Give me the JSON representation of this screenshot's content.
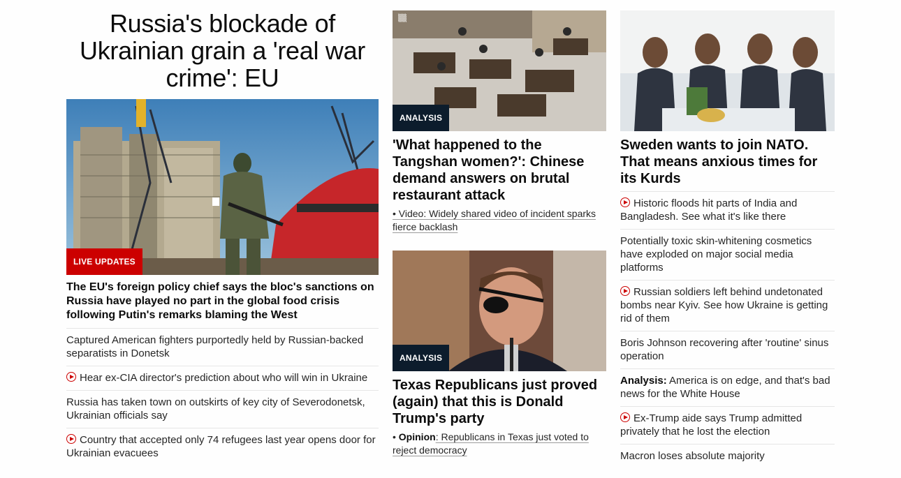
{
  "col1": {
    "headline": "Russia's blockade of Ukrainian grain a 'real war crime': EU",
    "badge": "LIVE UPDATES",
    "story_headline": "The EU's foreign policy chief says the bloc's sanctions on Russia have played no part in the global food crisis following Putin's remarks blaming the West",
    "links": [
      {
        "text": "Captured American fighters purportedly held by Russian-backed separatists in Donetsk",
        "video": false
      },
      {
        "text": "Hear ex-CIA director's prediction about who will win in Ukraine",
        "video": true
      },
      {
        "text": "Russia has taken town on outskirts of key city of Severodonetsk, Ukrainian officials say",
        "video": false
      },
      {
        "text": "Country that accepted only 74 refugees last year opens door for Ukrainian evacuees",
        "video": true
      }
    ]
  },
  "col2": {
    "story1": {
      "badge": "ANALYSIS",
      "headline": "'What happened to the Tangshan women?': Chinese demand answers on brutal restaurant attack",
      "sub": "• Video: Widely shared video of incident sparks fierce backlash"
    },
    "story2": {
      "badge": "ANALYSIS",
      "headline": "Texas Republicans just proved (again) that this is Donald Trump's party",
      "sub_label": "Opinion",
      "sub": ": Republicans in Texas just voted to reject democracy"
    }
  },
  "col3": {
    "headline": "Sweden wants to join NATO. That means anxious times for its Kurds",
    "links": [
      {
        "text": "Historic floods hit parts of India and Bangladesh. See what it's like there",
        "video": true,
        "label": ""
      },
      {
        "text": "Potentially toxic skin-whitening cosmetics have exploded on major social media platforms",
        "video": false,
        "label": ""
      },
      {
        "text": "Russian soldiers left behind undetonated bombs near Kyiv. See how Ukraine is getting rid of them",
        "video": true,
        "label": ""
      },
      {
        "text": "Boris Johnson recovering after 'routine' sinus operation",
        "video": false,
        "label": ""
      },
      {
        "text": " America is on edge, and that's bad news for the White House",
        "video": false,
        "label": "Analysis:"
      },
      {
        "text": "Ex-Trump aide says Trump admitted privately that he lost the election",
        "video": true,
        "label": ""
      },
      {
        "text": "Macron loses absolute majority",
        "video": false,
        "label": ""
      }
    ]
  }
}
